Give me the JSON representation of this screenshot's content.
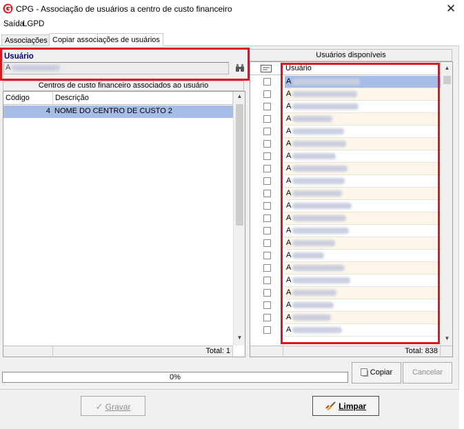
{
  "window": {
    "title": "CPG - Associação de usuários a centro de custo financeiro",
    "close_glyph": "✕"
  },
  "menu": {
    "items": [
      "Saída",
      "LGPD"
    ]
  },
  "tabs": [
    "Associações",
    "Copiar associações de usuários"
  ],
  "user_box": {
    "label": "Usuário",
    "value_prefix": "A"
  },
  "left_grid": {
    "caption": "Centros de custo financeiro associados ao usuário",
    "columns": [
      "Código",
      "Descrição"
    ],
    "rows": [
      {
        "codigo": "4",
        "descricao": "NOME DO CENTRO DE CUSTO 2"
      }
    ],
    "total": "Total: 1"
  },
  "right_grid": {
    "caption": "Usuários disponíveis",
    "column": "Usuário",
    "row_prefix": "A",
    "visible_rows": 21,
    "total": "Total: 838"
  },
  "progress": {
    "text": "0%",
    "value": 0
  },
  "buttons": {
    "copiar": "Copiar",
    "cancelar": "Cancelar",
    "gravar": "Gravar",
    "limpar": "Limpar"
  },
  "colors": {
    "accent_red": "#e0141e",
    "selection": "#a6bde8",
    "label_blue": "#000080"
  }
}
